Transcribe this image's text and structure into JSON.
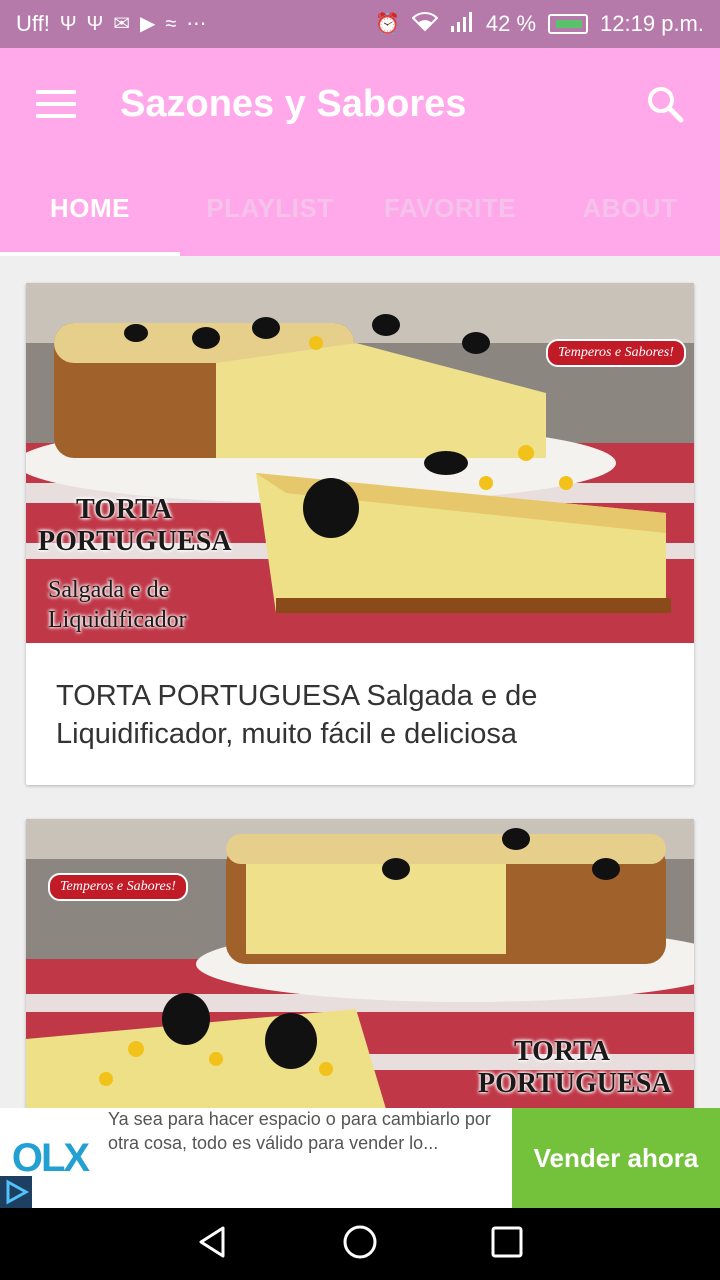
{
  "status_bar": {
    "left_text": "Uff!",
    "battery_percent": "42 %",
    "time": "12:19 p.m."
  },
  "app_bar": {
    "title": "Sazones y Sabores"
  },
  "tabs": [
    {
      "label": "HOME",
      "active": true
    },
    {
      "label": "PLAYLIST",
      "active": false
    },
    {
      "label": "FAVORITE",
      "active": false
    },
    {
      "label": "ABOUT",
      "active": false
    }
  ],
  "videos": [
    {
      "title": "TORTA PORTUGUESA Salgada e de Liquidificador, muito fácil e deliciosa",
      "thumb_caption_1": "TORTA",
      "thumb_caption_2": "PORTUGUESA",
      "thumb_sub_1": "Salgada e de",
      "thumb_sub_2": "Liquidificador",
      "thumb_badge": "Temperos e Sabores!"
    },
    {
      "title": "",
      "thumb_caption_1": "TORTA",
      "thumb_caption_2": "PORTUGUESA",
      "thumb_badge": "Temperos e Sabores!"
    }
  ],
  "ad": {
    "brand": "OLX",
    "text": "Ya sea para hacer espacio o para cambiarlo por otra cosa, todo es válido para vender lo...",
    "cta": "Vender ahora"
  },
  "colors": {
    "app_bar": "#ffa8ea",
    "status_bar": "#b57aaa",
    "cta": "#74c13b"
  }
}
